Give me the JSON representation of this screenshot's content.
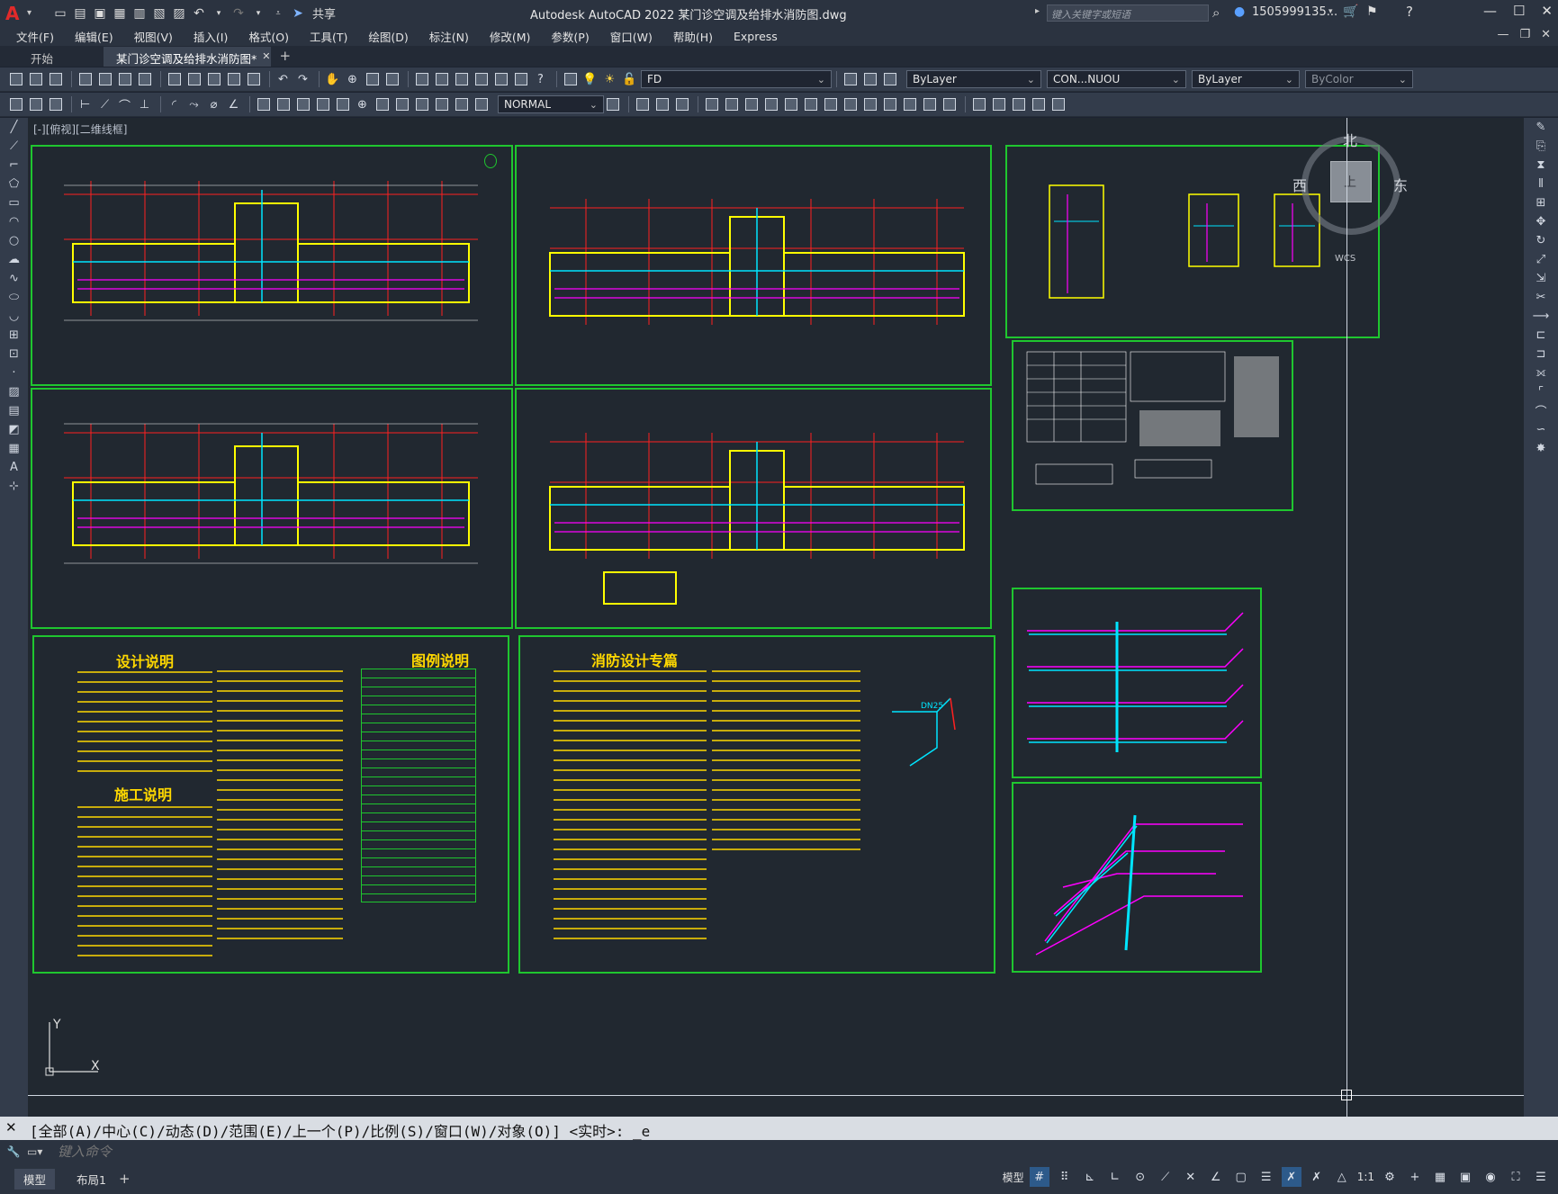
{
  "app": {
    "logo": "A",
    "title": "Autodesk AutoCAD 2022    某门诊空调及给排水消防图.dwg",
    "share_label": "共享",
    "search_placeholder": "键入关键字或短语",
    "user": "1505999135...",
    "colors": {
      "accent": "#e02a2a",
      "frame": "#1fc62f",
      "text_yellow": "#ffd800"
    }
  },
  "menu": {
    "items": [
      "文件(F)",
      "编辑(E)",
      "视图(V)",
      "插入(I)",
      "格式(O)",
      "工具(T)",
      "绘图(D)",
      "标注(N)",
      "修改(M)",
      "参数(P)",
      "窗口(W)",
      "帮助(H)",
      "Express"
    ]
  },
  "tabs": {
    "start": "开始",
    "active": "某门诊空调及给排水消防图*",
    "add": "+"
  },
  "toolbar": {
    "layer_value": "FD",
    "color_value": "ByLayer",
    "linetype_value": "CON...NUOU",
    "lineweight_value": "ByLayer",
    "plotstyle_value": "ByColor",
    "dimstyle_value": "NORMAL"
  },
  "viewport": {
    "label": "[-][俯视][二维线框]",
    "viewcube": {
      "north": "北",
      "west": "西",
      "east": "东",
      "top": "上",
      "wcs": "WCS"
    },
    "ucs_y": "Y",
    "ucs_x": "X"
  },
  "drawings": {
    "notes1_title": "设计说明",
    "notes2_title": "施工说明",
    "legend_title": "图例说明",
    "fire_title": "消防设计专篇",
    "pipe_label": "DN25"
  },
  "command": {
    "history": "[全部(A)/中心(C)/动态(D)/范围(E)/上一个(P)/比例(S)/窗口(W)/对象(O)] <实时>: _e",
    "placeholder": "键入命令"
  },
  "status": {
    "model_tab": "模型",
    "layout_tab": "布局1",
    "add": "+",
    "model_label": "模型",
    "scale": "1:1"
  }
}
